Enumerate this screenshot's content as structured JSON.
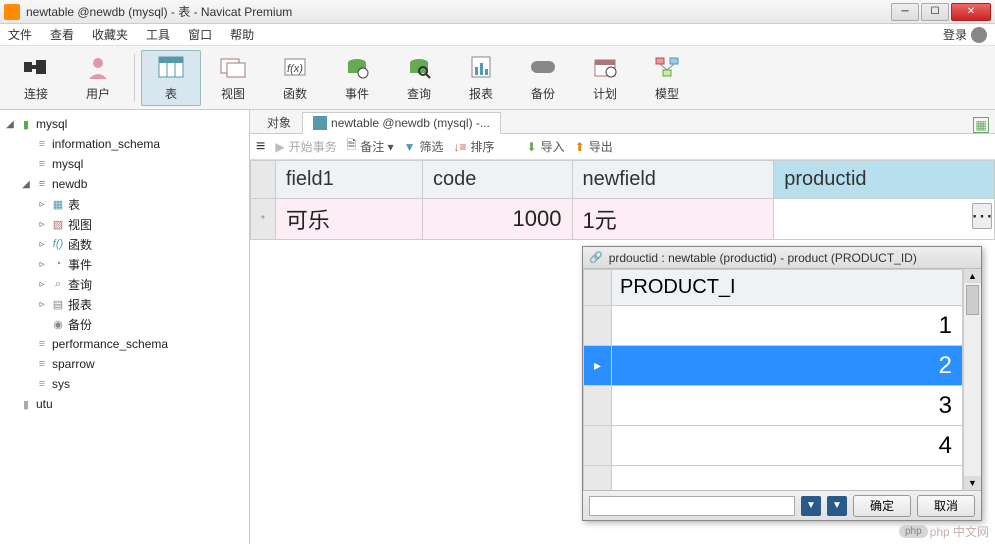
{
  "window": {
    "title": "newtable @newdb (mysql) - 表 - Navicat Premium"
  },
  "menu": {
    "file": "文件",
    "view": "查看",
    "fav": "收藏夹",
    "tool": "工具",
    "win": "窗口",
    "help": "帮助",
    "login": "登录"
  },
  "toolbar": {
    "conn": "连接",
    "user": "用户",
    "table": "表",
    "vw": "视图",
    "func": "函数",
    "event": "事件",
    "query": "查询",
    "report": "报表",
    "backup": "备份",
    "plan": "计划",
    "model": "模型"
  },
  "tree": {
    "root": "mysql",
    "dbs": [
      {
        "name": "information_schema"
      },
      {
        "name": "mysql"
      },
      {
        "name": "newdb",
        "open": true,
        "children": [
          {
            "name": "表",
            "hi": true
          },
          {
            "name": "视图"
          },
          {
            "name": "函数"
          },
          {
            "name": "事件"
          },
          {
            "name": "查询"
          },
          {
            "name": "报表"
          },
          {
            "name": "备份"
          }
        ]
      },
      {
        "name": "performance_schema"
      },
      {
        "name": "sparrow"
      },
      {
        "name": "sys"
      }
    ],
    "other": "utu"
  },
  "tabs": {
    "obj": "对象",
    "active": "newtable @newdb (mysql) -..."
  },
  "subtb": {
    "begin": "开始事务",
    "note": "备注 ▾",
    "filter": "筛选",
    "sort": "排序",
    "import": "导入",
    "export": "导出"
  },
  "grid": {
    "headers": [
      "field1",
      "code",
      "newfield",
      "productid"
    ],
    "row": {
      "field1": "可乐",
      "code": "1000",
      "newfield": "1元",
      "productid": ""
    }
  },
  "popup": {
    "title": "prdouctid  : newtable (productid) - product (PRODUCT_ID)",
    "header": "PRODUCT_I",
    "rows": [
      "1",
      "2",
      "3",
      "4"
    ],
    "selected": 1,
    "ok": "确定",
    "cancel": "取消"
  },
  "watermark": "php 中文网"
}
